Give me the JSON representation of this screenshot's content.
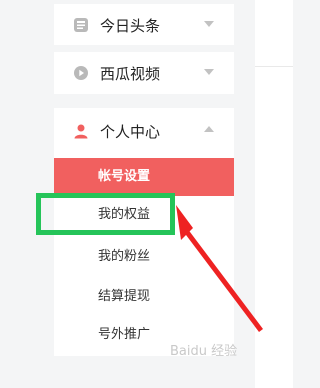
{
  "sidebar": {
    "groups": [
      {
        "label": "今日头条",
        "icon": "toutiao-icon",
        "expanded": false
      },
      {
        "label": "西瓜视频",
        "icon": "xigua-play-icon",
        "expanded": false
      },
      {
        "label": "个人中心",
        "icon": "user-icon",
        "expanded": true,
        "items": [
          {
            "label": "帐号设置",
            "active": true
          },
          {
            "label": "我的权益",
            "active": false
          },
          {
            "label": "我的粉丝",
            "active": false
          },
          {
            "label": "结算提现",
            "active": false
          },
          {
            "label": "号外推广",
            "active": false
          }
        ]
      }
    ]
  },
  "annotation": {
    "highlight_color": "#25c459",
    "arrow_color": "#ee2222"
  },
  "colors": {
    "accent": "#f1605f",
    "user_icon": "#f1605f"
  },
  "watermark": {
    "text": "Baidu 经验"
  }
}
